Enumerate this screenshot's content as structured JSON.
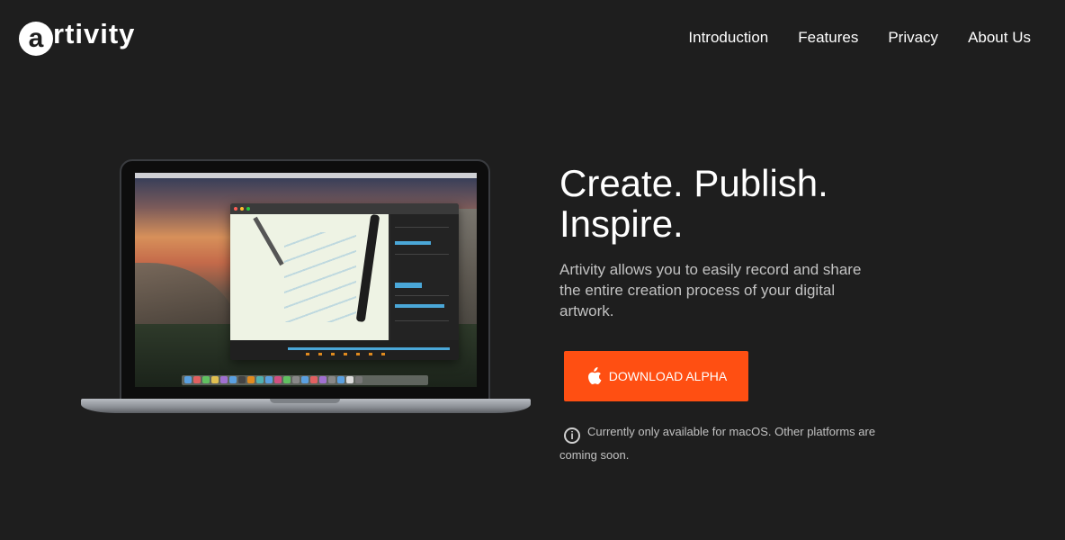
{
  "brand": {
    "logo_letter": "a",
    "logo_rest": "rtivity"
  },
  "nav": {
    "items": [
      {
        "label": "Introduction"
      },
      {
        "label": "Features"
      },
      {
        "label": "Privacy"
      },
      {
        "label": "About Us"
      }
    ]
  },
  "hero": {
    "title_line1": "Create. Publish.",
    "title_line2": "Inspire.",
    "description": "Artivity allows you to easily record and share the entire creation process of your digital artwork.",
    "download_label": "DOWNLOAD ALPHA",
    "availability_note": "Currently only available for macOS. Other platforms are coming soon."
  },
  "colors": {
    "background": "#1e1e1e",
    "accent": "#ff4f12",
    "muted_text": "#c2c2c2"
  },
  "icons": {
    "download": "apple-icon",
    "note": "info-icon"
  }
}
